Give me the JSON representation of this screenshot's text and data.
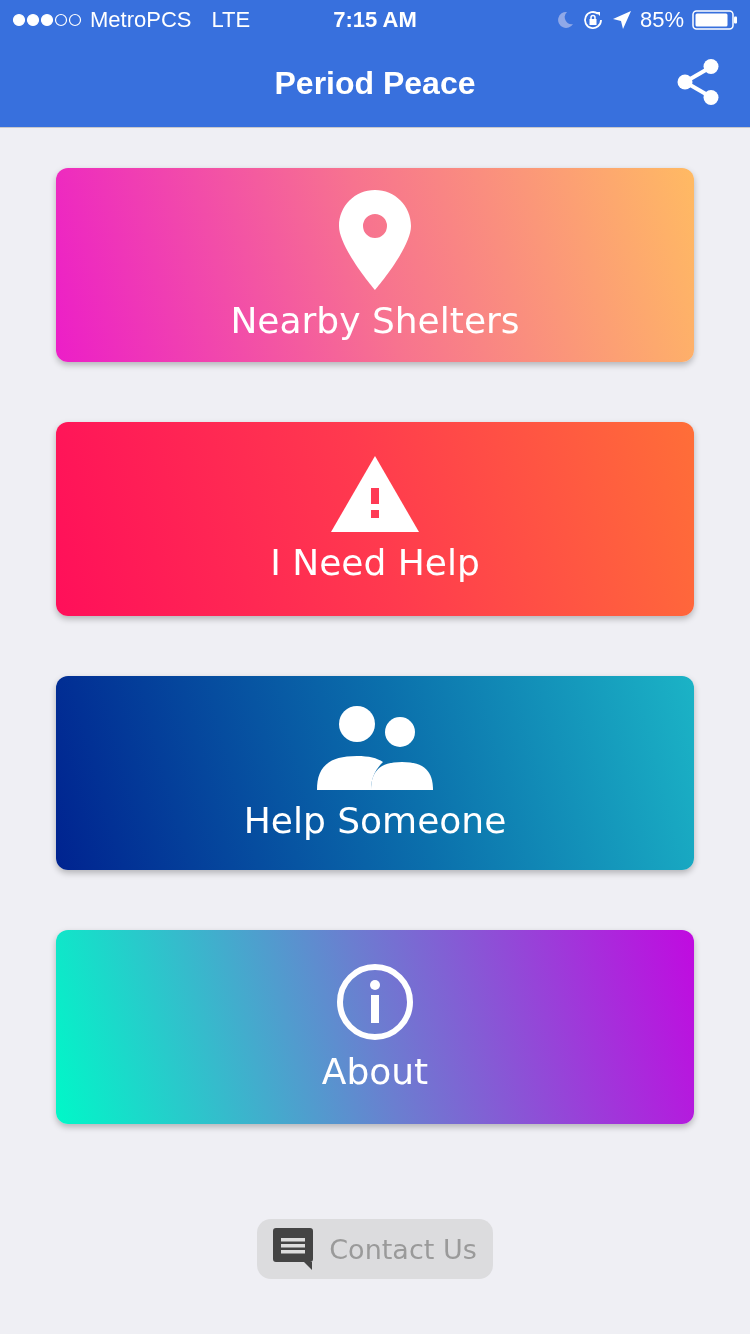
{
  "status_bar": {
    "carrier": "MetroPCS",
    "network": "LTE",
    "time": "7:15 AM",
    "battery": "85%"
  },
  "nav": {
    "title": "Period Peace"
  },
  "cards": [
    {
      "kind": "pin",
      "label": "Nearby Shelters"
    },
    {
      "kind": "warning",
      "label": "I Need Help"
    },
    {
      "kind": "people",
      "label": "Help Someone"
    },
    {
      "kind": "info",
      "label": "About"
    }
  ],
  "contact_button": {
    "label": "Contact Us"
  }
}
